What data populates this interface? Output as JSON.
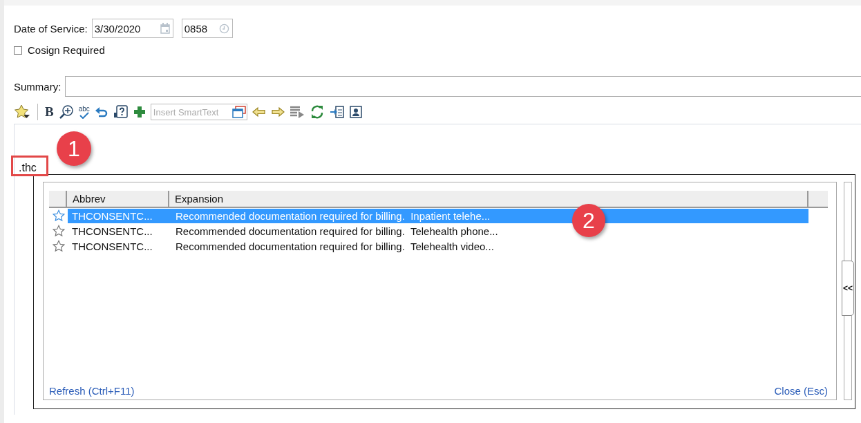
{
  "date_of_service": {
    "label": "Date of Service:",
    "date": "3/30/2020",
    "time": "0858"
  },
  "cosign": {
    "label": "Cosign Required",
    "checked": false
  },
  "summary": {
    "label": "Summary:"
  },
  "toolbar": {
    "bold_label": "B",
    "spell_label": "abc",
    "smarttext_placeholder": "Insert SmartText"
  },
  "editor": {
    "text": ".thc"
  },
  "popup": {
    "columns": [
      "Abbrev",
      "Expansion"
    ],
    "rows": [
      {
        "abbrev": "THCONSENTC...",
        "expansion": "Recommended documentation required for billing.  Inpatient telehe...",
        "selected": true
      },
      {
        "abbrev": "THCONSENTC...",
        "expansion": "Recommended documentation required for billing.  Telehealth phone...",
        "selected": false
      },
      {
        "abbrev": "THCONSENTC...",
        "expansion": "Recommended documentation required for billing.  Telehealth video...",
        "selected": false
      }
    ],
    "refresh": "Refresh (Ctrl+F11)",
    "close": "Close (Esc)",
    "collapse": "<<"
  },
  "annotations": [
    {
      "label": "1"
    },
    {
      "label": "2"
    }
  ]
}
